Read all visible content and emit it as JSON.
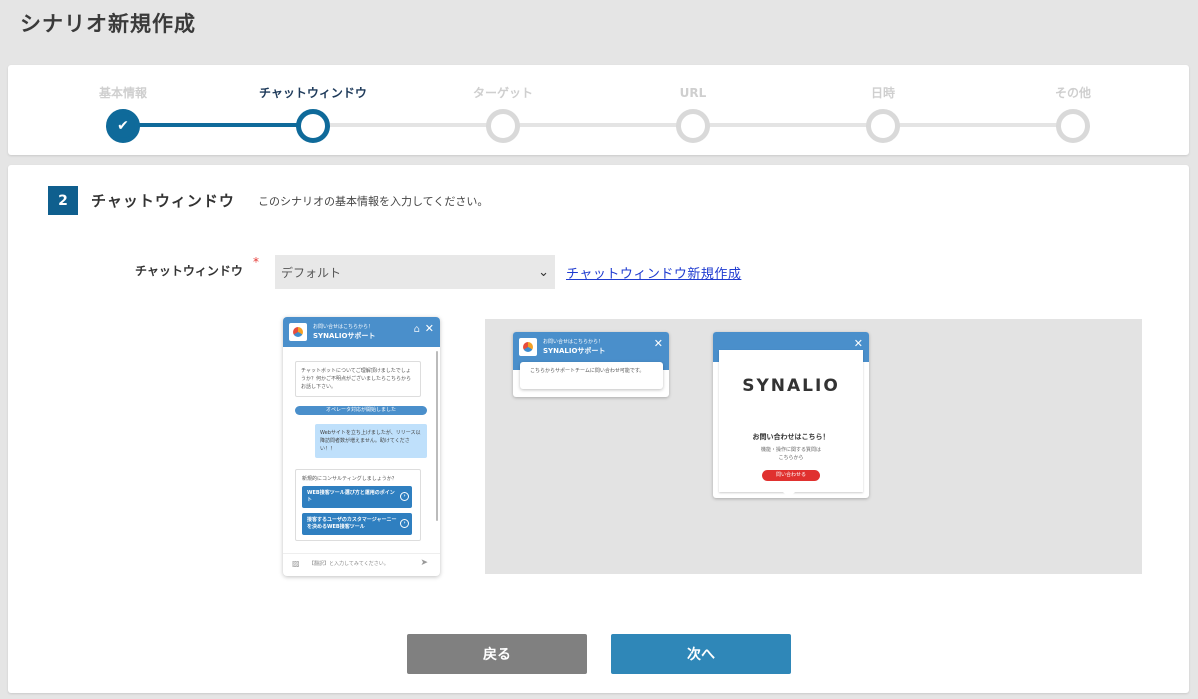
{
  "page": {
    "title": "シナリオ新規作成"
  },
  "stepper": {
    "steps": [
      {
        "label": "基本情報",
        "state": "done"
      },
      {
        "label": "チャットウィンドウ",
        "state": "active"
      },
      {
        "label": "ターゲット",
        "state": "pending"
      },
      {
        "label": "URL",
        "state": "pending"
      },
      {
        "label": "日時",
        "state": "pending"
      },
      {
        "label": "その他",
        "state": "pending"
      }
    ],
    "check_glyph": "✔"
  },
  "section": {
    "number": "2",
    "title": "チャットウィンドウ",
    "description": "このシナリオの基本情報を入力してください。"
  },
  "form": {
    "chat_window_label": "チャットウィンドウ",
    "required_mark": "*",
    "selected_value": "デフォルト",
    "chevron": "⌄",
    "create_link": "チャットウィンドウ新規作成"
  },
  "chat_preview": {
    "subtitle": "お問い合せはこちらから！",
    "name": "SYNALIOサポート",
    "home_glyph": "⌂",
    "close_glyph": "✕",
    "bot_message": "チャットボットについてご理解頂けましたでしょうか？何かご不明点がございましたらこちらからお話し下さい。",
    "operator_notice": "オペレータ対応が開始しました",
    "user_message": "Webサイトを立ち上げましたが、リリース以降訪問者数が増えません。助けてください！！",
    "choice_question": "新規的にコンサルティングしましょうか？",
    "choice_1": "WEB接客ツール選び方と運用のポイント",
    "choice_2": "接客するユーザのカスタマージャーニーを決めるWEB接客ツール",
    "choice_arrow": "›",
    "input_placeholder": "【翻訳】と入力してみてください。",
    "image_glyph": "▨",
    "send_glyph": "➤"
  },
  "banner_preview": {
    "subtitle": "お問い合せはこちらから！",
    "name": "SYNALIOサポート",
    "close_glyph": "✕",
    "message": "こちらからサポートチームに問い合わせ可能です。"
  },
  "popup_preview": {
    "close_glyph": "✕",
    "logo_text": "SYNALIO",
    "title": "お問い合わせはこちら！",
    "subtitle_line1": "機能・操作に関する質問は",
    "subtitle_line2": "こちらから",
    "button": "問い合わせる"
  },
  "actions": {
    "back": "戻る",
    "next": "次へ"
  },
  "colors": {
    "primary": "#0f6a9a",
    "next_button": "#2f87b8",
    "back_button": "#808080",
    "link": "#1f3bd0",
    "chat_header": "#4a8fcb"
  }
}
